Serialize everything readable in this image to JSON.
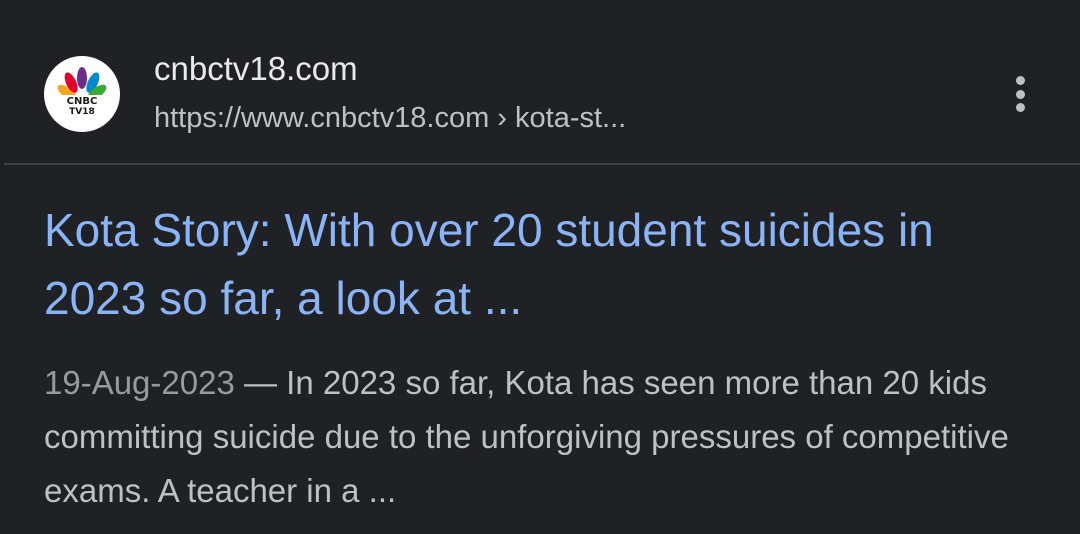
{
  "result": {
    "site_name": "cnbctv18.com",
    "url": "https://www.cnbctv18.com › kota-st...",
    "favicon": {
      "icon": "cnbc-tv18-logo-icon",
      "text_line1": "CNBC",
      "text_line2": "TV18"
    },
    "menu_icon": "more-vert-icon",
    "title": "Kota Story: With over 20 student suicides in 2023 so far, a look at ...",
    "date": "19-Aug-2023",
    "separator": " — ",
    "snippet": "In 2023 so far, Kota has seen more than 20 kids committing suicide due to the unforgiving pressures of competitive exams. A teacher in a ..."
  },
  "colors": {
    "background": "#202124",
    "title_link": "#8ab4f8",
    "primary_text": "#e8eaed",
    "secondary_text": "#bdc1c6",
    "divider": "#3c4043"
  }
}
